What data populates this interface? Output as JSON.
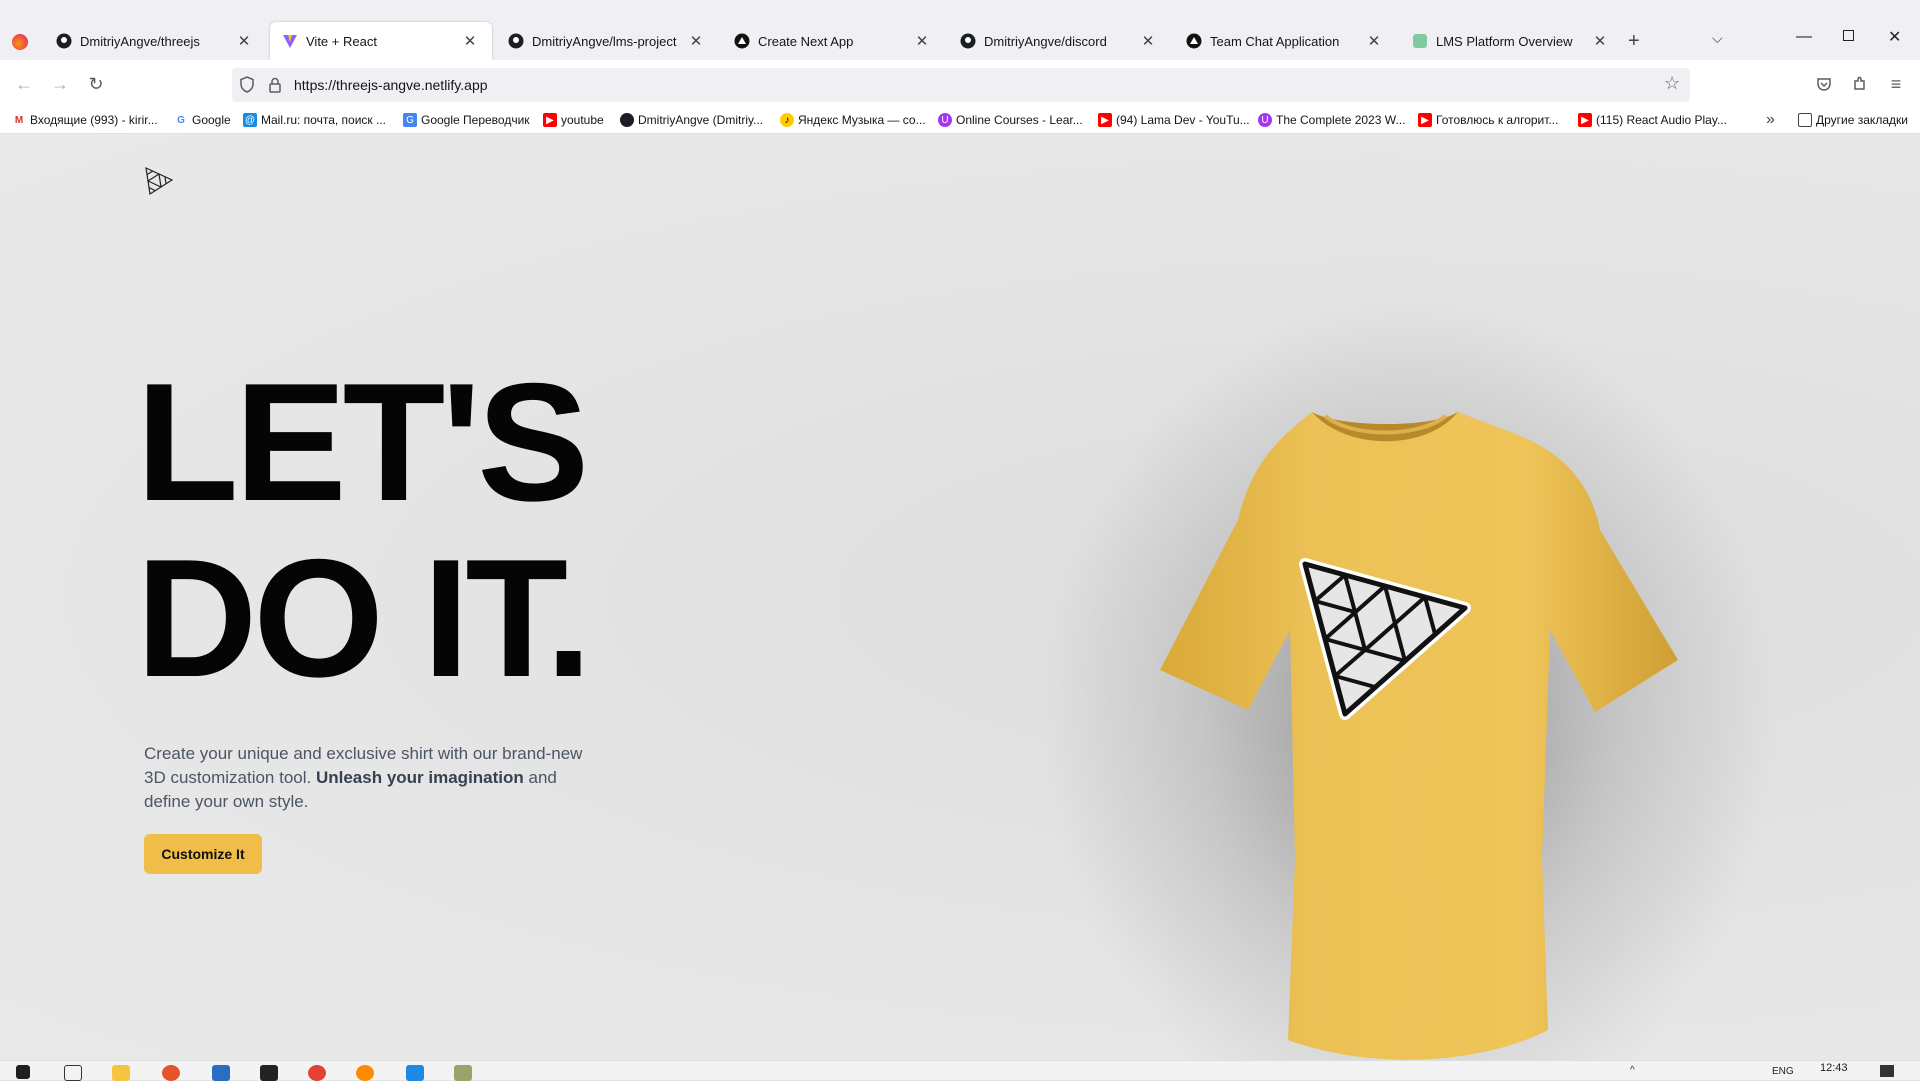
{
  "browser": {
    "tabs": [
      {
        "title": "DmitriyAngve/threejs",
        "icon": "github-icon"
      },
      {
        "title": "Vite + React",
        "icon": "vite-icon",
        "active": true
      },
      {
        "title": "DmitriyAngve/lms-project",
        "icon": "github-icon"
      },
      {
        "title": "Create Next App",
        "icon": "vercel-icon"
      },
      {
        "title": "DmitriyAngve/discord",
        "icon": "github-icon"
      },
      {
        "title": "Team Chat Application",
        "icon": "vercel-icon"
      },
      {
        "title": "LMS Platform Overview",
        "icon": "lms-icon"
      }
    ],
    "url": "https://threejs-angve.netlify.app",
    "bookmarks": [
      {
        "label": "Входящие (993) - kirir...",
        "icon": "gmail-icon"
      },
      {
        "label": "Google",
        "icon": "google-icon"
      },
      {
        "label": "Mail.ru: почта, поиск ...",
        "icon": "mailru-icon"
      },
      {
        "label": "Google Переводчик",
        "icon": "translate-icon"
      },
      {
        "label": "youtube",
        "icon": "youtube-icon"
      },
      {
        "label": "DmitriyAngve (Dmitriy...",
        "icon": "github-icon"
      },
      {
        "label": "Яндекс Музыка — со...",
        "icon": "yandex-music-icon"
      },
      {
        "label": "Online Courses - Lear...",
        "icon": "udemy-icon"
      },
      {
        "label": "(94) Lama Dev - YouTu...",
        "icon": "youtube-icon"
      },
      {
        "label": "The Complete 2023 W...",
        "icon": "udemy-icon"
      },
      {
        "label": "Готовлюсь к алгорит...",
        "icon": "youtube-icon"
      },
      {
        "label": "(115) React Audio Play...",
        "icon": "youtube-icon"
      }
    ],
    "other_bookmarks": "Другие закладки"
  },
  "hero": {
    "title_line1": "LET'S",
    "title_line2": "DO IT.",
    "desc_part1": "Create your unique and exclusive shirt with our brand-new 3D customization tool. ",
    "desc_bold": "Unleash your imagination",
    "desc_part2": " and define your own style.",
    "cta_label": "Customize It"
  },
  "shirt": {
    "color": "#efbd48",
    "decal": "threejs-logo"
  },
  "colors": {
    "accent": "#efbd48",
    "background": "#e3e3e3"
  },
  "taskbar": {
    "clock": "12:43",
    "lang": "ENG"
  }
}
